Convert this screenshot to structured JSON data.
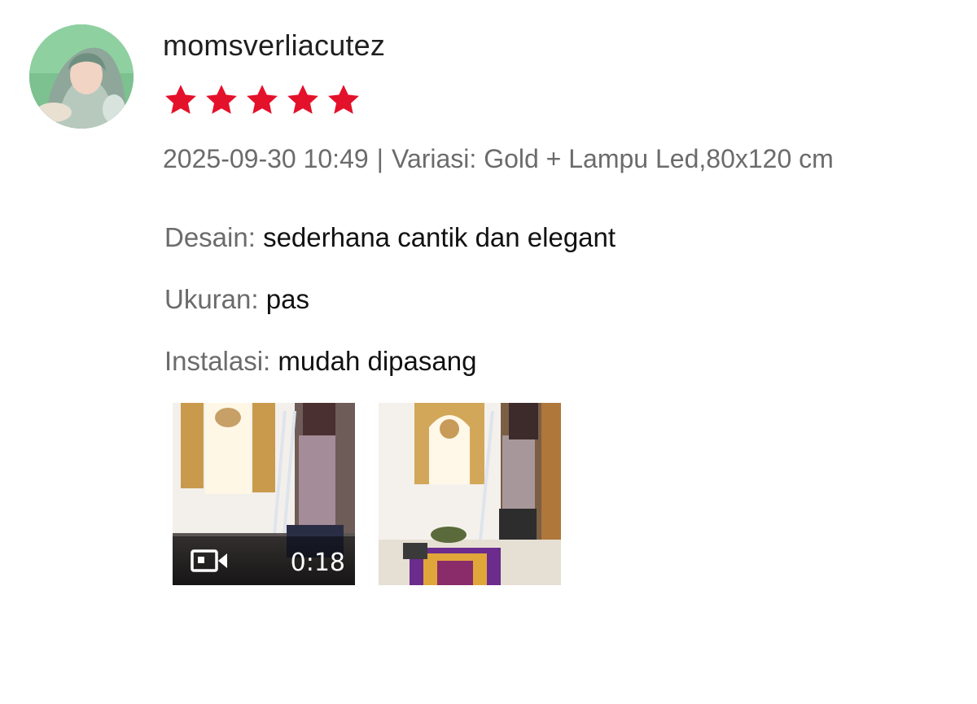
{
  "review": {
    "username": "momsverliacutez",
    "rating": 5,
    "rating_max": 5,
    "star_color": "#e4112b",
    "date": "2025-09-30 10:49",
    "separator": "|",
    "variation": "Variasi: Gold + Lampu Led,80x120 cm",
    "attributes": [
      {
        "label": "Desain:",
        "value": "sederhana cantik dan elegant"
      },
      {
        "label": "Ukuran:",
        "value": "pas"
      },
      {
        "label": "Instalasi:",
        "value": "mudah dipasang"
      }
    ],
    "media": [
      {
        "type": "video",
        "duration": "0:18",
        "icon": "video-camera-icon"
      },
      {
        "type": "image"
      }
    ]
  }
}
